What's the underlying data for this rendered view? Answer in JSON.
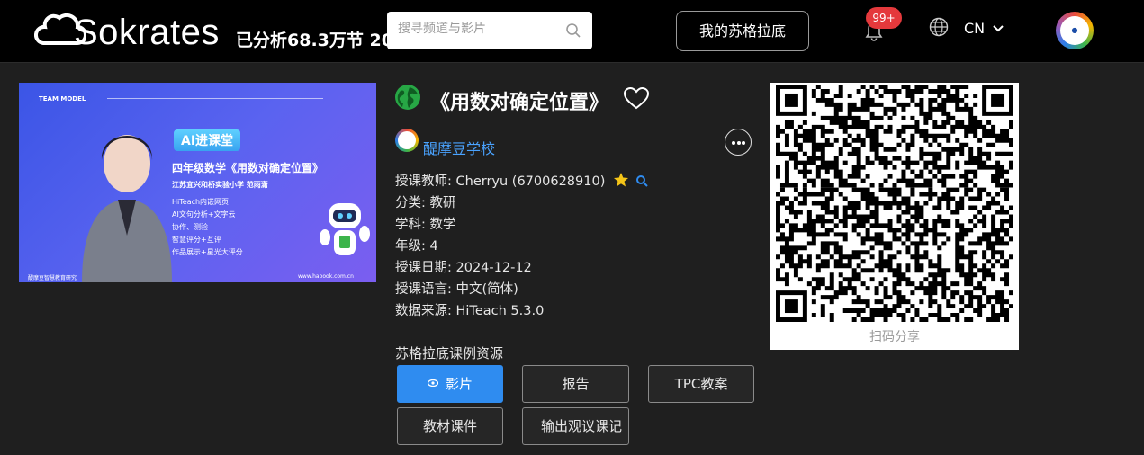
{
  "header": {
    "logo_text": "Sokrates",
    "analyzed_text": "已分析68.3万节 20",
    "search_placeholder": "搜寻频道与影片",
    "my_sokrates_label": "我的苏格拉底",
    "notification_badge": "99+",
    "language": "CN"
  },
  "thumbnail": {
    "brand": "TEAM MODEL",
    "tag": "AI进课堂",
    "headline": "四年级数学《用数对确定位置》",
    "school_teacher": "江苏宜兴和桥实验小学    范雨潇",
    "features": [
      "HiTeach内嵌网页",
      "AI文句分析+文字云",
      "协作、测验",
      "智慧评分+互评",
      "作品展示+星光大评分"
    ],
    "footer_left": "醍摩豆智慧教育研究",
    "footer_right": "www.habook.com.cn"
  },
  "lesson": {
    "title": "《用数对确定位置》",
    "school": "醍摩豆学校",
    "teacher_label": "授课教师:",
    "teacher_value": "Cherryu (6700628910)",
    "category_label": "分类:",
    "category_value": "教研",
    "subject_label": "学科:",
    "subject_value": "数学",
    "grade_label": "年级:",
    "grade_value": "4",
    "date_label": "授课日期:",
    "date_value": "2024-12-12",
    "language_label": "授课语言:",
    "language_value": "中文(简体)",
    "source_label": "数据来源:",
    "source_value": "HiTeach 5.3.0"
  },
  "resources": {
    "title": "苏格拉底课例资源",
    "video": "影片",
    "report": "报告",
    "tpc": "TPC教案",
    "materials": "教材课件",
    "export": "输出观议课记"
  },
  "qr": {
    "caption": "扫码分享"
  },
  "colors": {
    "accent": "#2f8cf0",
    "link": "#4aa3ff",
    "badge": "#e4393c",
    "background": "#1f1f1f"
  }
}
